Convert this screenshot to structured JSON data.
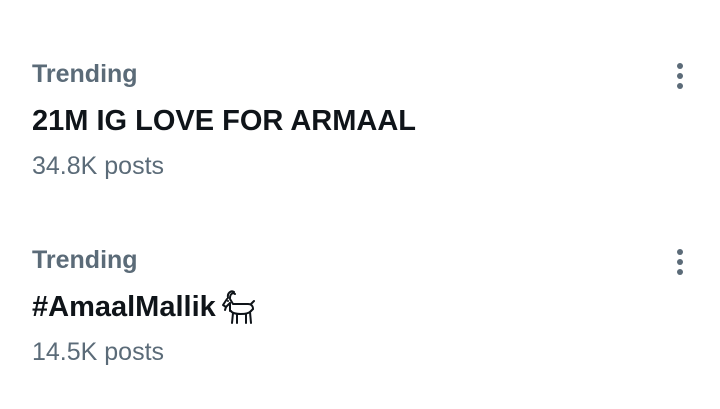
{
  "trends": [
    {
      "category": "Trending",
      "topic": "21M IG LOVE FOR ARMAAL",
      "posts": "34.8K posts",
      "more_icon": "more-vertical-icon"
    },
    {
      "category": "Trending",
      "topic": "#AmaalMallik",
      "topic_emoji": "goat-icon",
      "posts": "14.5K posts",
      "more_icon": "more-vertical-icon"
    }
  ],
  "colors": {
    "primary_text": "#0f1419",
    "secondary_text": "#5b6b78",
    "icon": "#5b6b78",
    "background": "#ffffff"
  }
}
